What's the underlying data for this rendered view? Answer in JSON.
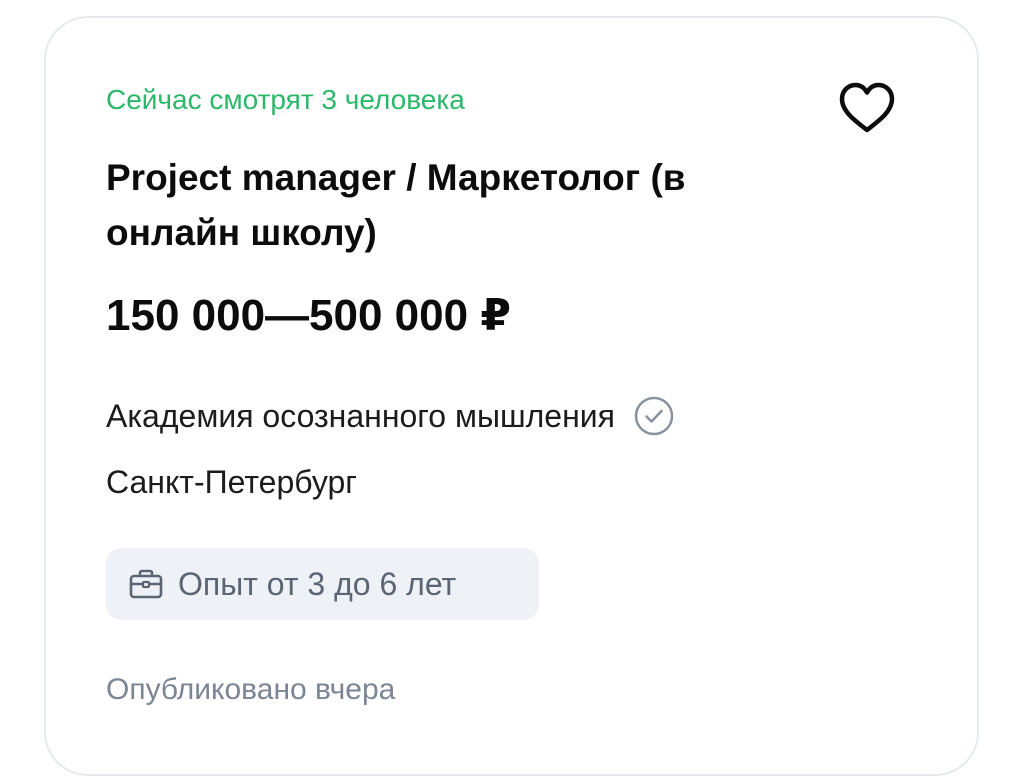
{
  "vacancy": {
    "viewers_text": "Сейчас смотрят 3 человека",
    "title": "Project manager / Маркетолог (в онлайн школу)",
    "salary": "150 000—500 000 ₽",
    "employer": "Академия осознанного мышления",
    "city": "Санкт-Петербург",
    "experience": "Опыт от 3 до 6 лет",
    "published": "Опубликовано вчера"
  },
  "icons": {
    "favorite": "heart-icon",
    "verified": "check-circle-icon",
    "experience": "briefcase-icon"
  },
  "colors": {
    "viewers": "#2cb86a",
    "chip_background": "#eef1f5",
    "muted_text": "#7b8594"
  }
}
